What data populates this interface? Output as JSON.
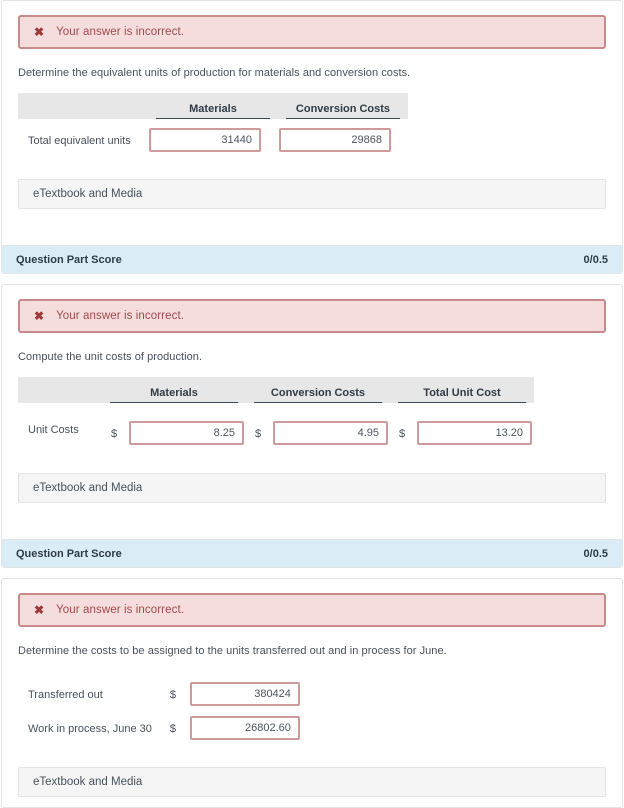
{
  "alert": {
    "icon": "x-mark-icon",
    "message": "Your answer is incorrect."
  },
  "etextbook_label": "eTextbook and Media",
  "score_bar": {
    "label": "Question Part Score",
    "value": "0/0.5"
  },
  "currency_symbol": "$",
  "cards": [
    {
      "id": "part-a",
      "prompt": "Determine the equivalent units of production for materials and conversion costs.",
      "table": {
        "columns": [
          "Materials",
          "Conversion Costs"
        ],
        "rows": [
          {
            "label": "Total equivalent units",
            "cells": [
              {
                "prefix": "",
                "value": "31440"
              },
              {
                "prefix": "",
                "value": "29868"
              }
            ]
          }
        ]
      }
    },
    {
      "id": "part-b",
      "prompt": "Compute the unit costs of production.",
      "table": {
        "columns": [
          "Materials",
          "Conversion Costs",
          "Total Unit Cost"
        ],
        "rows": [
          {
            "label": "Unit Costs",
            "cells": [
              {
                "prefix": "$",
                "value": "8.25"
              },
              {
                "prefix": "$",
                "value": "4.95"
              },
              {
                "prefix": "$",
                "value": "13.20"
              }
            ]
          }
        ]
      }
    },
    {
      "id": "part-c",
      "prompt": "Determine the costs to be assigned to the units transferred out and in process for June.",
      "rows": [
        {
          "label": "Transferred out",
          "prefix": "$",
          "value": "380424"
        },
        {
          "label": "Work in process, June 30",
          "prefix": "$",
          "value": "26802.60"
        }
      ]
    }
  ]
}
